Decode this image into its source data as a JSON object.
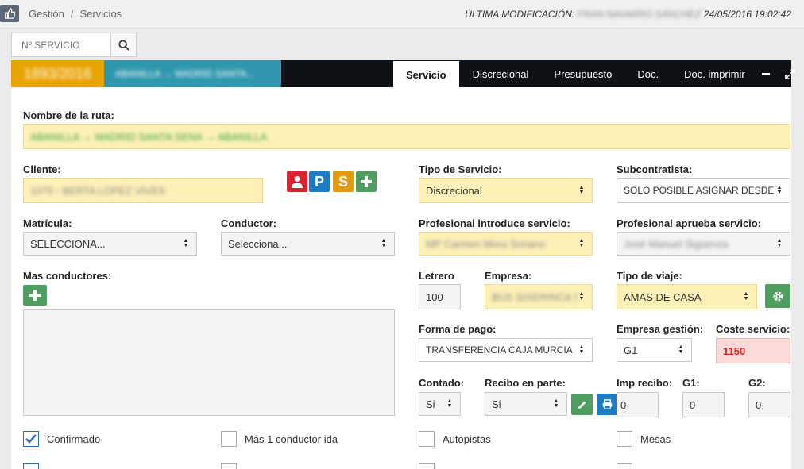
{
  "breadcrumb": {
    "items": [
      "Gestión",
      "Servicios"
    ],
    "separator": "/"
  },
  "last_modified": {
    "label": "ÚLTIMA MODIFICACIÓN:",
    "user": "FRAN NAVARRO SÁNCHEZ",
    "date": "24/05/2016 19:02:42"
  },
  "search": {
    "placeholder": "Nº SERVICIO"
  },
  "header": {
    "service_id": "1893/2016",
    "route_short": "ABANILLA → MADRID SANTA..."
  },
  "tabs": [
    "Servicio",
    "Discrecional",
    "Presupuesto",
    "Doc.",
    "Doc. imprimir"
  ],
  "form": {
    "ruta_label": "Nombre de la ruta:",
    "ruta_value": "ABANILLA → MADRID SANTA SENA → ABANILLA",
    "cliente_label": "Cliente:",
    "cliente_value": "1070 - BERTA LOPEZ VIVES",
    "client_buttons": [
      "P",
      "S"
    ],
    "tipo_servicio_label": "Tipo de Servicio:",
    "tipo_servicio_value": "Discrecional",
    "subcontratista_label": "Subcontratista:",
    "subcontratista_value": "SOLO POSIBLE ASIGNAR DESDE",
    "matricula_label": "Matrícula:",
    "matricula_value": "SELECCIONA...",
    "conductor_label": "Conductor:",
    "conductor_value": "Selecciona...",
    "prof_introduce_label": "Profesional introduce servicio:",
    "prof_introduce_value": "MP Carmen Mora Soriano",
    "prof_aprueba_label": "Profesional aprueba servicio:",
    "prof_aprueba_value": "José Manuel Sigüenza",
    "mas_conductores_label": "Mas conductores:",
    "letrero_label": "Letrero",
    "letrero_value": "100",
    "empresa_label": "Empresa:",
    "empresa_value": "BUS SIXERINCA S.",
    "tipo_viaje_label": "Tipo de viaje:",
    "tipo_viaje_value": "AMAS DE CASA",
    "forma_pago_label": "Forma de pago:",
    "forma_pago_value": "TRANSFERENCIA CAJA MURCIA",
    "empresa_gestion_label": "Empresa gestión:",
    "empresa_gestion_value": "G1",
    "coste_label": "Coste servicio:",
    "coste_value": "1150",
    "contado_label": "Contado:",
    "contado_value": "Si",
    "recibo_label": "Recibo en parte:",
    "recibo_value": "Si",
    "imp_recibo_label": "Imp recibo:",
    "imp_recibo_value": "0",
    "g1_label": "G1:",
    "g1_value": "0",
    "g2_label": "G2:",
    "g2_value": "0"
  },
  "checkboxes": [
    {
      "label": "Confirmado",
      "checked": true
    },
    {
      "label": "Más 1 conductor ida",
      "checked": false
    },
    {
      "label": "Autopistas",
      "checked": false
    },
    {
      "label": "Mesas",
      "checked": false
    }
  ],
  "colors": {
    "accent_orange": "#e8a400",
    "accent_teal": "#2f97ad",
    "header_dark": "#0d1217",
    "btn_red": "#d9232f",
    "btn_blue": "#1c7cc6",
    "btn_green": "#4f9d5f",
    "field_yellow": "#fdf1b8",
    "field_pink": "#fbd9d9"
  }
}
